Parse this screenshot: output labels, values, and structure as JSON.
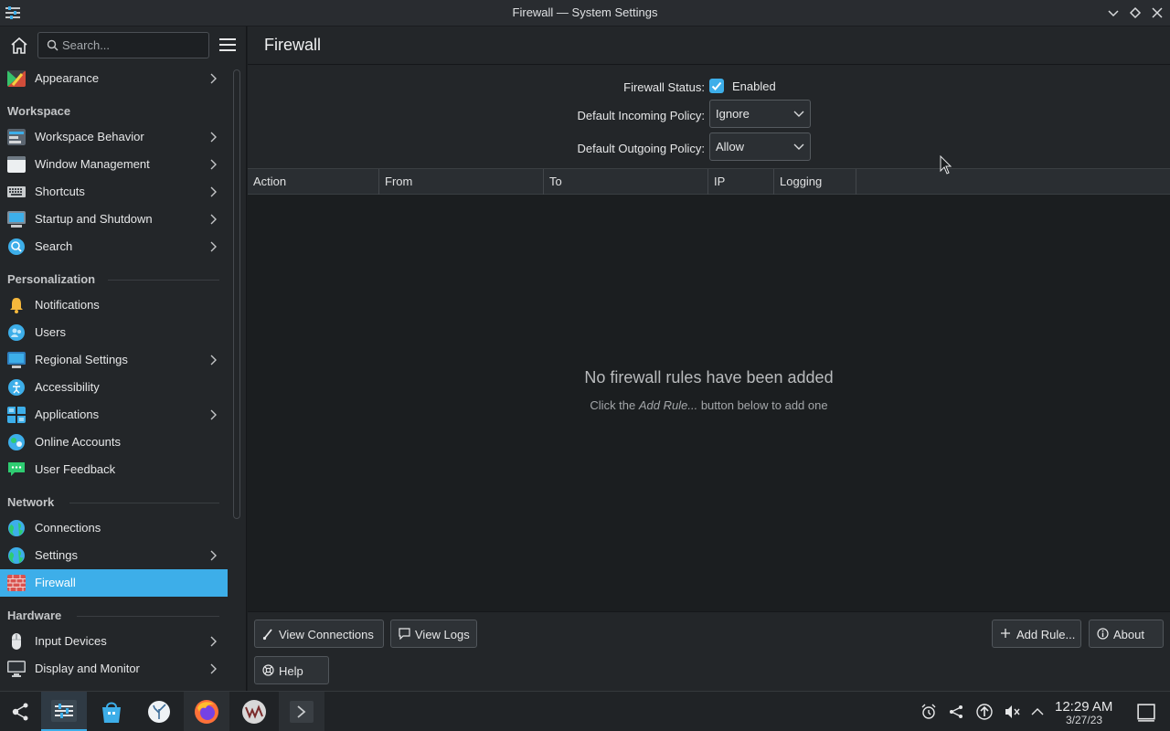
{
  "window": {
    "title": "Firewall — System Settings"
  },
  "search": {
    "placeholder": "Search..."
  },
  "sidebar": {
    "top_item": {
      "label": "Appearance"
    },
    "categories": {
      "workspace": "Workspace",
      "personalization": "Personalization",
      "network": "Network",
      "hardware": "Hardware"
    },
    "items": {
      "workspace_behavior": "Workspace Behavior",
      "window_management": "Window Management",
      "shortcuts": "Shortcuts",
      "startup_shutdown": "Startup and Shutdown",
      "search": "Search",
      "notifications": "Notifications",
      "users": "Users",
      "regional_settings": "Regional Settings",
      "accessibility": "Accessibility",
      "applications": "Applications",
      "online_accounts": "Online Accounts",
      "user_feedback": "User Feedback",
      "connections": "Connections",
      "settings": "Settings",
      "firewall": "Firewall",
      "input_devices": "Input Devices",
      "display_monitor": "Display and Monitor"
    }
  },
  "page": {
    "title": "Firewall",
    "firewall_status_label": "Firewall Status:",
    "firewall_status_value": "Enabled",
    "firewall_enabled": true,
    "incoming_label": "Default Incoming Policy:",
    "incoming_value": "Ignore",
    "outgoing_label": "Default Outgoing Policy:",
    "outgoing_value": "Allow"
  },
  "table": {
    "columns": {
      "action": "Action",
      "from": "From",
      "to": "To",
      "ip": "IP",
      "logging": "Logging"
    },
    "empty_title": "No firewall rules have been added",
    "empty_prefix": "Click the ",
    "empty_emph": "Add Rule...",
    "empty_suffix": " button below to add one"
  },
  "footer": {
    "view_connections": "View Connections",
    "view_logs": "View Logs",
    "add_rule": "Add Rule...",
    "about": "About",
    "help": "Help"
  },
  "taskbar": {
    "time": "12:29 AM",
    "date": "3/27/23"
  },
  "colors": {
    "accent": "#3daee9",
    "window_bg": "#1b1e20",
    "panel_bg": "#232629"
  }
}
